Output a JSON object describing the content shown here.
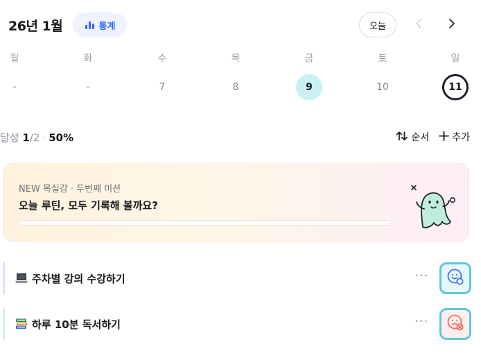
{
  "header": {
    "month_title": "26년 1월",
    "stats_label": "통계",
    "today_label": "오늘",
    "prev_icon": "chevron-left-icon",
    "next_icon": "chevron-right-icon"
  },
  "week": {
    "weekdays": [
      "월",
      "화",
      "수",
      "목",
      "금",
      "토",
      "일"
    ],
    "days": [
      {
        "label": "-",
        "state": "empty"
      },
      {
        "label": "-",
        "state": "empty"
      },
      {
        "label": "7",
        "state": "normal"
      },
      {
        "label": "8",
        "state": "normal"
      },
      {
        "label": "9",
        "state": "selected"
      },
      {
        "label": "10",
        "state": "normal"
      },
      {
        "label": "11",
        "state": "today"
      }
    ]
  },
  "summary": {
    "label": "달성",
    "done": "1",
    "total": "/2",
    "dot": "·",
    "percent": "50%",
    "sort_label": "순서",
    "add_label": "추가"
  },
  "banner": {
    "subtitle": "NEW 목실감 · 두번째 미션",
    "title": "오늘 루틴, 모두 기록해 볼까요?",
    "progress": 0
  },
  "tasks": [
    {
      "emoji": "laptop-icon",
      "label": "주차별 강의 수강하기",
      "more": "···",
      "status_icon": "smile-check-icon",
      "accent": "#d6e6f7"
    },
    {
      "emoji": "books-icon",
      "label": "하루 10분 독서하기",
      "more": "···",
      "status_icon": "sad-x-icon",
      "accent": "#d8f1e2"
    }
  ],
  "colors": {
    "accent_blue": "#2f66f6",
    "selected_day": "#c9f1f5",
    "status_border": "#5ec8d8",
    "fail_red": "#ef6b5b"
  }
}
